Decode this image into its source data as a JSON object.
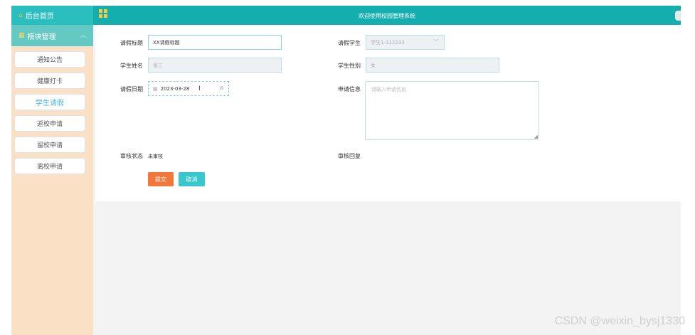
{
  "sidebar": {
    "home_label": "后台首页",
    "group_label": "模块管理",
    "items": [
      {
        "label": "通知公告"
      },
      {
        "label": "健康打卡"
      },
      {
        "label": "学生请假"
      },
      {
        "label": "返校申请"
      },
      {
        "label": "留校申请"
      },
      {
        "label": "离校申请"
      }
    ]
  },
  "header": {
    "title": "欢迎使用校园管理系统"
  },
  "form": {
    "leave_title_label": "请假标题",
    "leave_title_value": "XX请假标题",
    "leave_student_label": "请假学生",
    "leave_student_value": "学生1-112233",
    "student_name_label": "学生姓名",
    "student_name_value": "张三",
    "student_gender_label": "学生性别",
    "student_gender_value": "女",
    "leave_date_label": "请假日期",
    "leave_date_value": "2023-03-28",
    "apply_info_label": "申请信息",
    "apply_info_placeholder": "请输入申请信息",
    "review_status_label": "审核状态",
    "review_status_value": "未审核",
    "review_reply_label": "审核回复",
    "submit_label": "提交",
    "cancel_label": "取消"
  },
  "watermark": "CSDN @weixin_bysj1330"
}
